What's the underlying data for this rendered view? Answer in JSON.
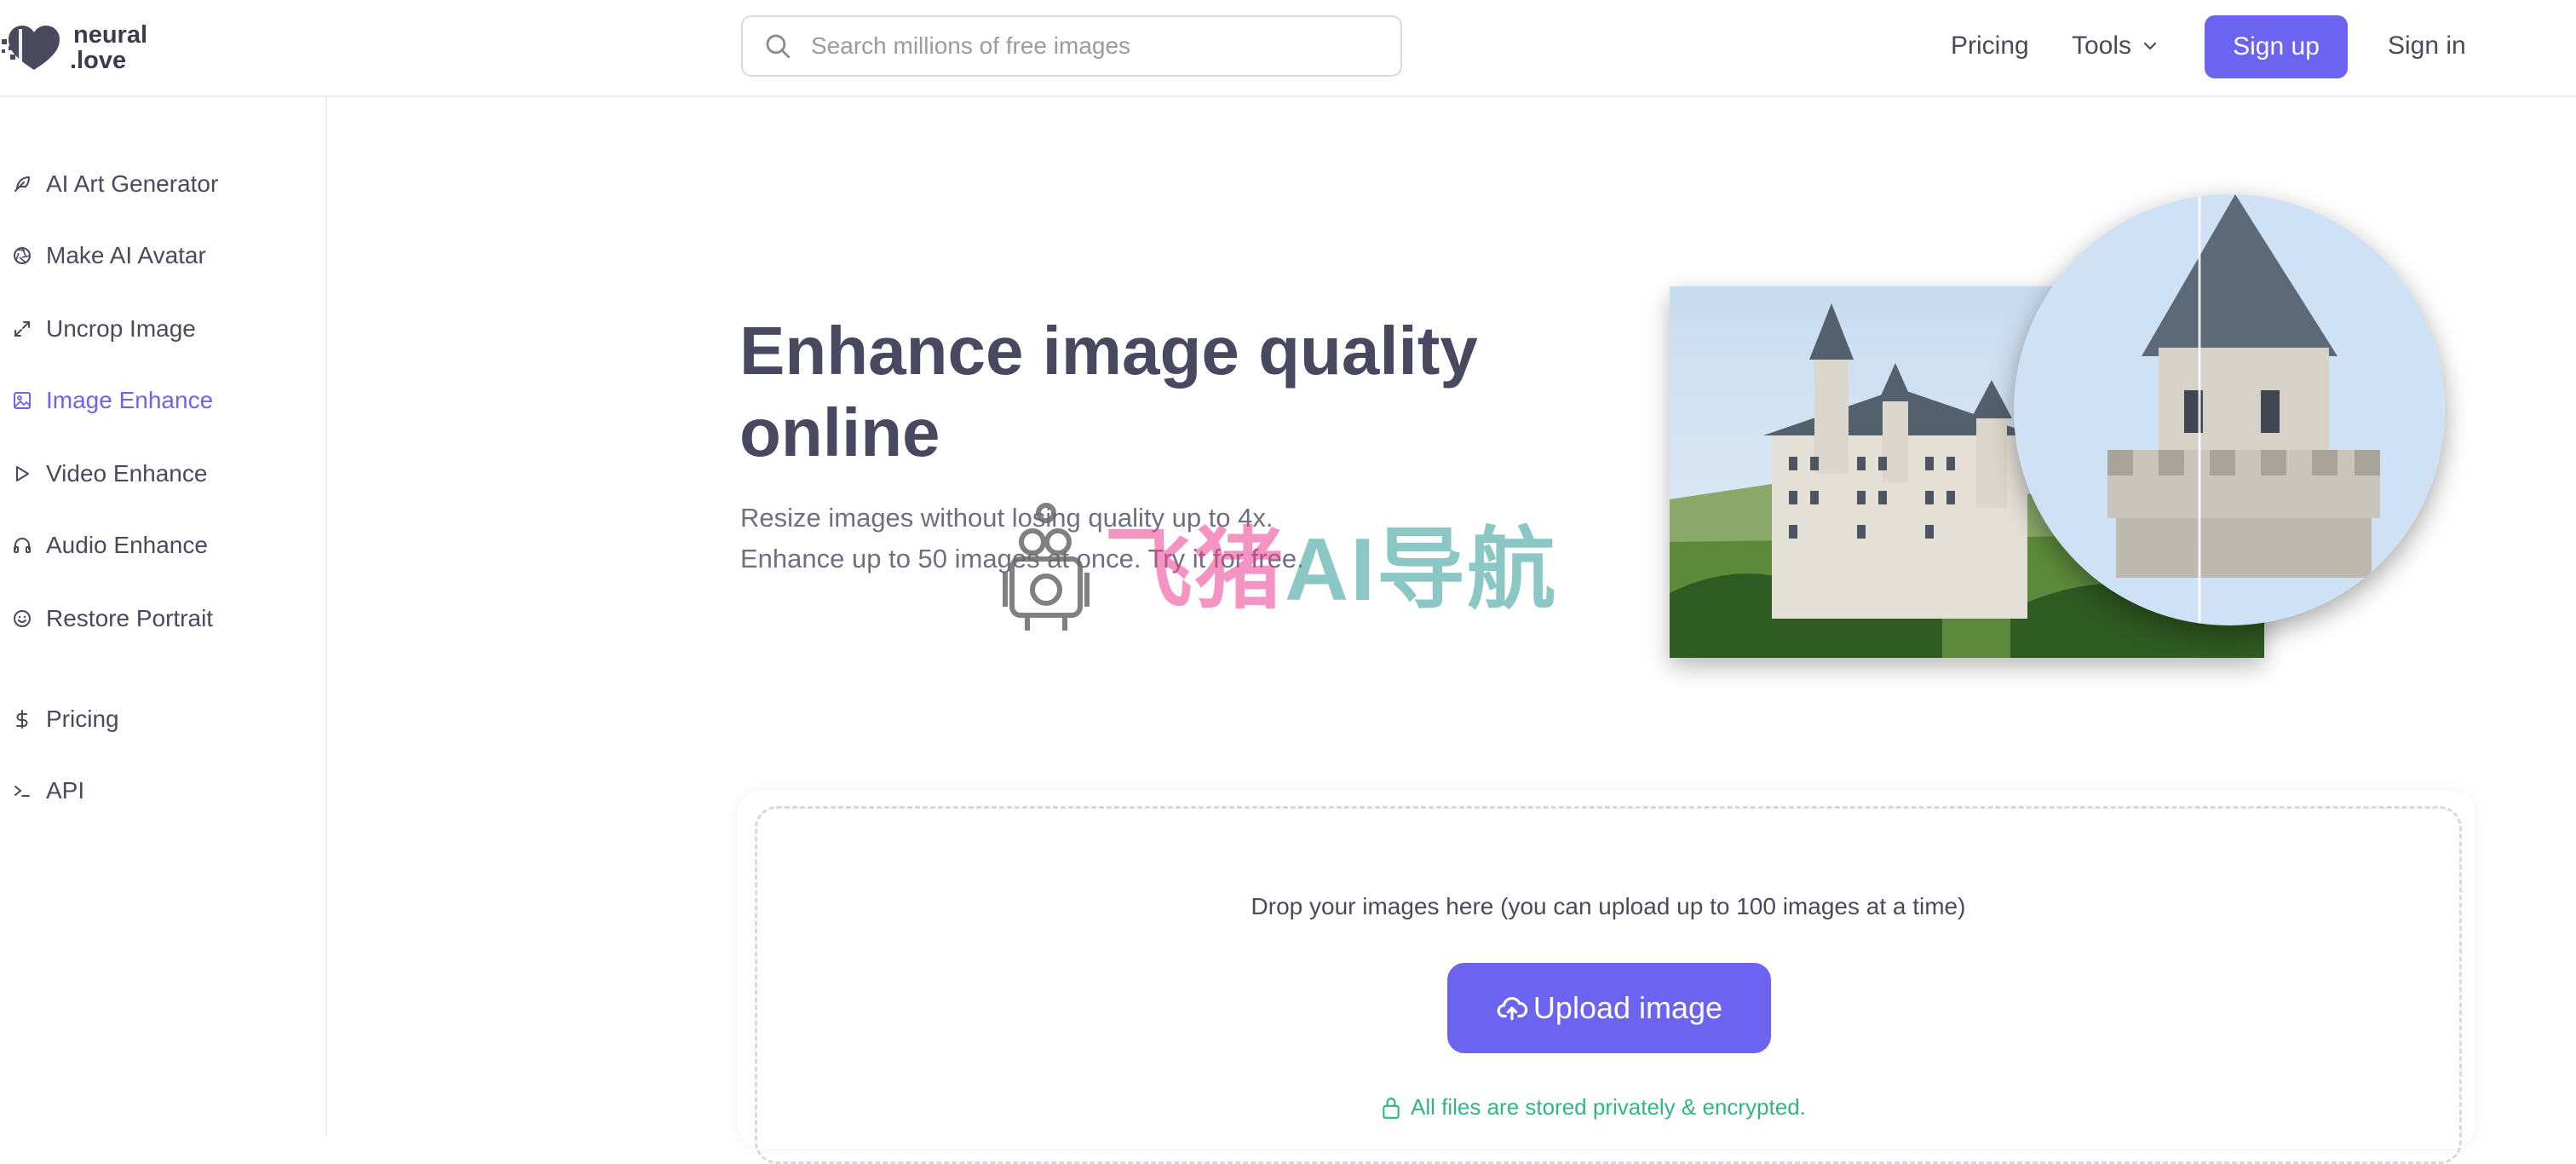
{
  "header": {
    "logo_line1": "neural",
    "logo_line2": ".love",
    "search_placeholder": "Search millions of free images",
    "nav_pricing": "Pricing",
    "nav_tools": "Tools",
    "signup": "Sign up",
    "signin": "Sign in"
  },
  "sidebar": {
    "items": [
      {
        "label": "AI Art Generator",
        "icon": "feather-icon"
      },
      {
        "label": "Make AI Avatar",
        "icon": "aperture-icon"
      },
      {
        "label": "Uncrop Image",
        "icon": "expand-icon"
      },
      {
        "label": "Image Enhance",
        "icon": "image-icon",
        "active": true
      },
      {
        "label": "Video Enhance",
        "icon": "play-icon"
      },
      {
        "label": "Audio Enhance",
        "icon": "headphones-icon"
      },
      {
        "label": "Restore Portrait",
        "icon": "smile-icon"
      },
      {
        "label": "Pricing",
        "icon": "dollar-icon"
      },
      {
        "label": "API",
        "icon": "terminal-icon"
      }
    ]
  },
  "hero": {
    "title": "Enhance image quality online",
    "subtitle_line1": "Resize images without losing quality up to 4x.",
    "subtitle_line2": "Enhance up to 50 images at once. Try it for free."
  },
  "watermark": {
    "text_pink": "飞猪",
    "text_teal": "AI导航"
  },
  "upload": {
    "drop_text": "Drop your images here (you can upload up to 100 images at a time)",
    "button": "Upload image",
    "privacy_note": "All files are stored privately & encrypted."
  },
  "colors": {
    "accent": "#6c63f0",
    "success": "#2eb87e",
    "text": "#4a4a5e"
  }
}
